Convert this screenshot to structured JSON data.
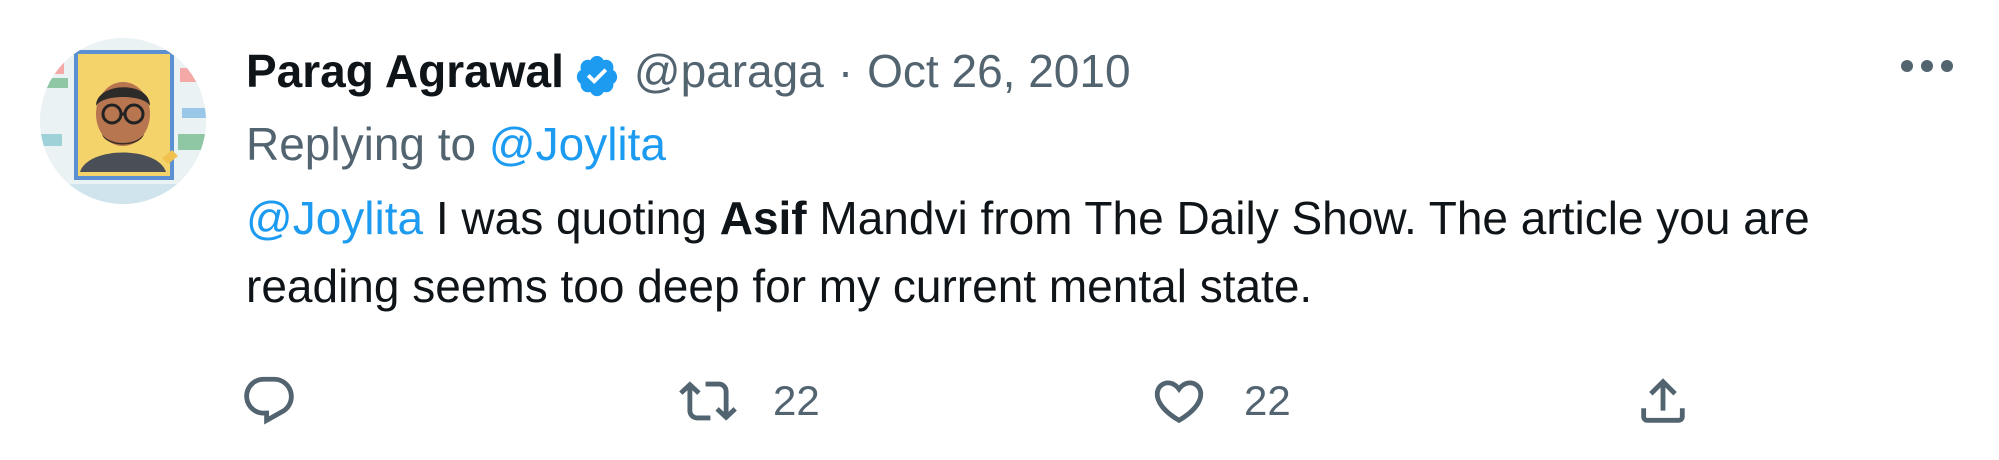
{
  "tweet": {
    "author_name": "Parag Agrawal",
    "handle": "@paraga",
    "separator": "·",
    "date": "Oct 26, 2010",
    "replying_prefix": "Replying to",
    "replying_to": "@Joylita",
    "body": {
      "mention": "@Joylita",
      "text_1": " I was quoting ",
      "bold": "Asif",
      "text_2": " Mandvi from The Daily Show. The article you are reading seems too deep for my current mental state."
    },
    "counts": {
      "retweets": "22",
      "likes": "22"
    }
  },
  "icons": {
    "verified": "verified-badge-icon",
    "more": "more-dots-icon",
    "reply": "reply-icon",
    "retweet": "retweet-icon",
    "like": "heart-icon",
    "share": "share-icon"
  },
  "colors": {
    "text": "#0f1419",
    "secondary": "#536471",
    "link": "#1d9bf0",
    "verified": "#1d9bf0"
  }
}
